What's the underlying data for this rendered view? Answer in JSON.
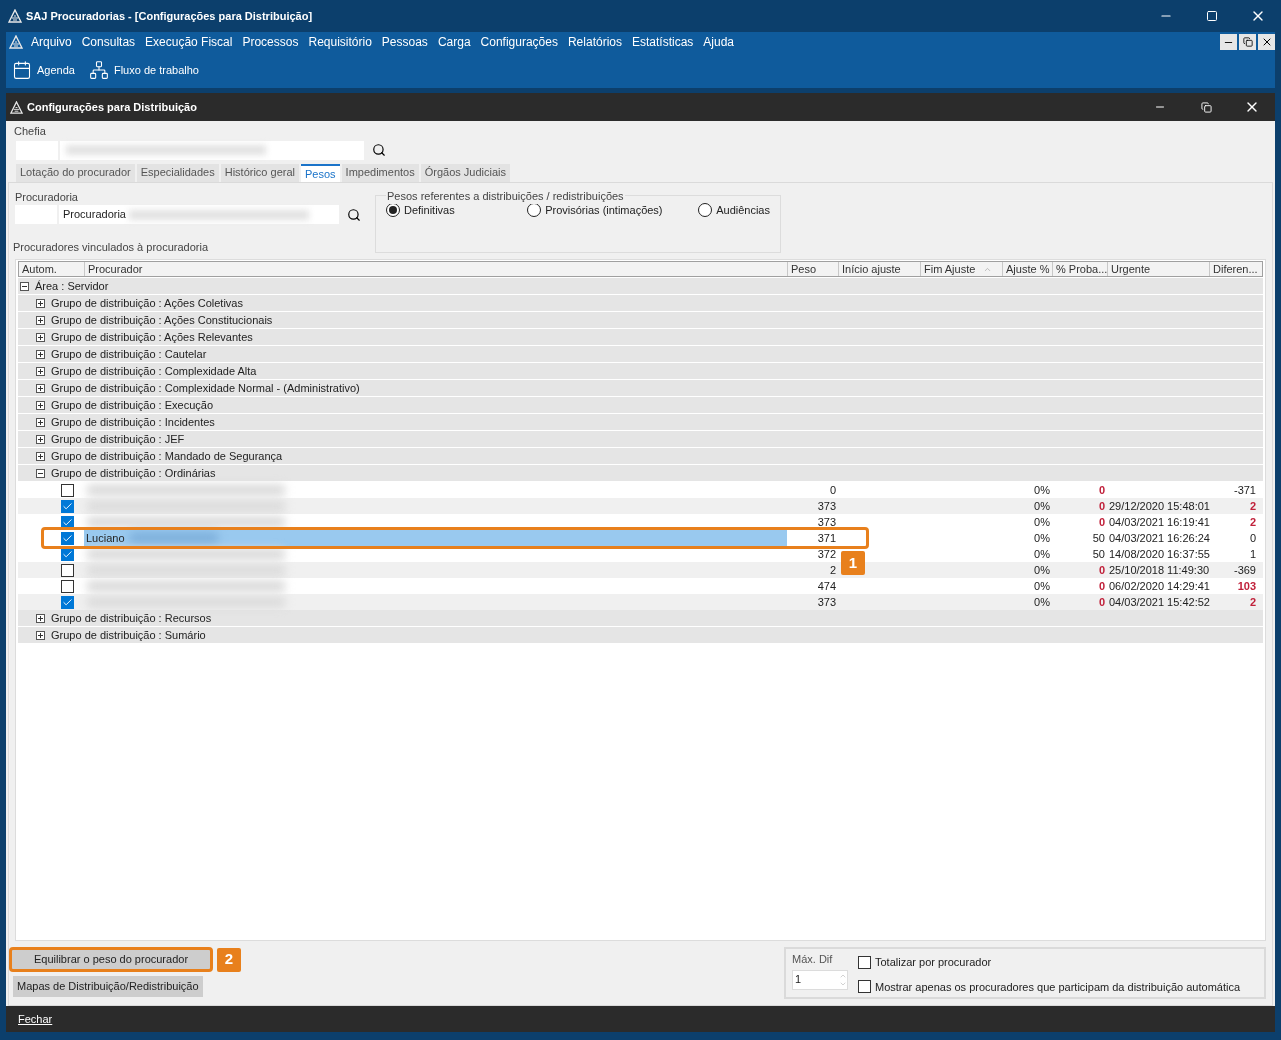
{
  "window": {
    "title": "SAJ Procuradorias - [Configurações para Distribuição]"
  },
  "menu": [
    "Arquivo",
    "Consultas",
    "Execução Fiscal",
    "Processos",
    "Requisitório",
    "Pessoas",
    "Carga",
    "Configurações",
    "Relatórios",
    "Estatísticas",
    "Ajuda"
  ],
  "toolbar": [
    {
      "label": "Agenda",
      "kind": "calendar"
    },
    {
      "label": "Fluxo de trabalho",
      "kind": "flow"
    }
  ],
  "child_window": {
    "title": "Configurações para Distribuição"
  },
  "chefia": {
    "label": "Chefia"
  },
  "tabs": [
    {
      "label": "Lotação do procurador",
      "selected": false
    },
    {
      "label": "Especialidades",
      "selected": false
    },
    {
      "label": "Histórico geral",
      "selected": false
    },
    {
      "label": "Pesos",
      "selected": true
    },
    {
      "label": "Impedimentos",
      "selected": false
    },
    {
      "label": "Órgãos Judiciais",
      "selected": false
    }
  ],
  "procuradoria": {
    "label": "Procuradoria",
    "value": "Procuradoria"
  },
  "pesos_group": {
    "title": "Pesos referentes a distribuições / redistribuições",
    "options": [
      {
        "label": "Definitivas",
        "selected": true
      },
      {
        "label": "Provisórias (intimações)",
        "selected": false
      },
      {
        "label": "Audiências",
        "selected": false
      }
    ]
  },
  "table": {
    "title": "Procuradores vinculados à procuradoria",
    "columns": [
      {
        "label": "Autom.",
        "sorted": false
      },
      {
        "label": "Procurador",
        "sorted": false
      },
      {
        "label": "Peso",
        "sorted": false
      },
      {
        "label": "Início ajuste",
        "sorted": false
      },
      {
        "label": "Fim Ajuste",
        "sorted": true
      },
      {
        "label": "Ajuste %",
        "sorted": false
      },
      {
        "label": "% Proba...",
        "sorted": false
      },
      {
        "label": "Urgente",
        "sorted": false
      },
      {
        "label": "Diferen...",
        "sorted": false
      }
    ],
    "tree": [
      {
        "label": "Área : Servidor",
        "expanded": true,
        "children": [
          {
            "label": "Grupo de distribuição : Ações Coletivas",
            "expanded": false
          },
          {
            "label": "Grupo de distribuição : Ações Constitucionais",
            "expanded": false
          },
          {
            "label": "Grupo de distribuição : Ações Relevantes",
            "expanded": false
          },
          {
            "label": "Grupo de distribuição : Cautelar",
            "expanded": false
          },
          {
            "label": "Grupo de distribuição : Complexidade Alta",
            "expanded": false
          },
          {
            "label": "Grupo de distribuição : Complexidade Normal - (Administrativo)",
            "expanded": false
          },
          {
            "label": "Grupo de distribuição : Execução",
            "expanded": false
          },
          {
            "label": "Grupo de distribuição : Incidentes",
            "expanded": false
          },
          {
            "label": "Grupo de distribuição : JEF",
            "expanded": false
          },
          {
            "label": "Grupo de distribuição : Mandado de Segurança",
            "expanded": false
          },
          {
            "label": "Grupo de distribuição : Ordinárias",
            "expanded": true,
            "members": [
              {
                "checked": false,
                "selected": false,
                "peso": "0",
                "ajuste": "0%",
                "proba": "0",
                "proba_alert": true,
                "diferenca": "-371",
                "diff_alert": false
              },
              {
                "checked": true,
                "selected": false,
                "peso": "373",
                "ajuste": "0%",
                "proba": "0",
                "proba_alert": true,
                "urgente": "29/12/2020 15:48:01",
                "diferenca": "2",
                "diff_alert": true
              },
              {
                "checked": true,
                "selected": false,
                "peso": "373",
                "ajuste": "0%",
                "proba": "0",
                "proba_alert": true,
                "urgente": "04/03/2021 16:19:41",
                "diferenca": "2",
                "diff_alert": true
              },
              {
                "name": "Luciano",
                "checked": true,
                "selected": true,
                "peso": "371",
                "ajuste": "0%",
                "proba": "50",
                "proba_alert": false,
                "urgente": "04/03/2021 16:26:24",
                "diferenca": "0",
                "diff_alert": false
              },
              {
                "checked": true,
                "selected": false,
                "peso": "372",
                "ajuste": "0%",
                "proba": "50",
                "proba_alert": false,
                "urgente": "14/08/2020 16:37:55",
                "diferenca": "1",
                "diff_alert": false
              },
              {
                "checked": false,
                "selected": false,
                "peso": "2",
                "ajuste": "0%",
                "proba": "0",
                "proba_alert": true,
                "urgente": "25/10/2018 11:49:30",
                "diferenca": "-369",
                "diff_alert": false
              },
              {
                "checked": false,
                "selected": false,
                "peso": "474",
                "ajuste": "0%",
                "proba": "0",
                "proba_alert": true,
                "urgente": "06/02/2020 14:29:41",
                "diferenca": "103",
                "diff_alert": true
              },
              {
                "checked": true,
                "selected": false,
                "peso": "373",
                "ajuste": "0%",
                "proba": "0",
                "proba_alert": true,
                "urgente": "04/03/2021 15:42:52",
                "diferenca": "2",
                "diff_alert": true
              }
            ]
          },
          {
            "label": "Grupo de distribuição : Recursos",
            "expanded": false
          },
          {
            "label": "Grupo de distribuição : Sumário",
            "expanded": false
          }
        ]
      }
    ]
  },
  "buttons": [
    "Equilibrar o peso do procurador",
    "Mapas de Distribuição/Redistribuição"
  ],
  "max_dif": {
    "label": "Máx. Dif",
    "value": "1"
  },
  "options": [
    {
      "label": "Totalizar por procurador",
      "checked": false
    },
    {
      "label": "Mostrar apenas os procuradores que participam da distribuição automática",
      "checked": false
    }
  ],
  "footer": {
    "button": "Fechar"
  },
  "callouts": [
    "1",
    "2"
  ]
}
